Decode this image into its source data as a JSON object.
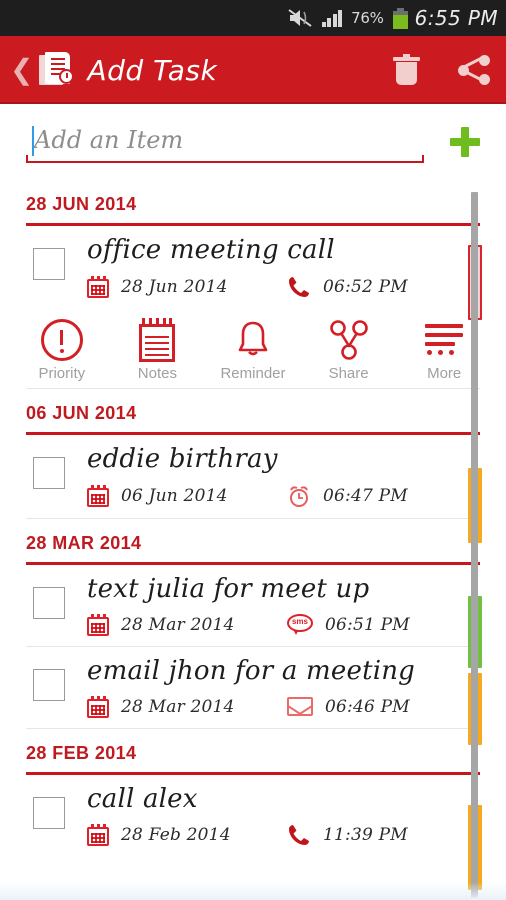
{
  "statusbar": {
    "mute_icon": "mute-vibrate-icon",
    "signal_icon": "signal-bars-icon",
    "battery_percent": "76%",
    "battery_icon": "battery-icon",
    "time": "6:55 PM"
  },
  "appbar": {
    "back_icon": "back-chevron-icon",
    "app_icon": "task-list-clock-icon",
    "title": "Add Task",
    "delete_icon": "trash-icon",
    "share_icon": "share-icon",
    "background_color": "#cc1b20"
  },
  "add_row": {
    "placeholder": "Add an Item",
    "value": "",
    "add_icon": "plus-icon",
    "add_icon_color": "#6dbd1e",
    "underline_color": "#c9161d"
  },
  "action_bar": {
    "items": [
      {
        "label": "Priority",
        "icon": "priority-exclamation-icon"
      },
      {
        "label": "Notes",
        "icon": "notepad-icon"
      },
      {
        "label": "Reminder",
        "icon": "bell-icon"
      },
      {
        "label": "Share",
        "icon": "share-network-icon"
      },
      {
        "label": "More",
        "icon": "more-lines-icon"
      }
    ]
  },
  "groups": [
    {
      "header": "28 JUN 2014",
      "tasks": [
        {
          "title": "office meeting call",
          "date": "28 Jun 2014",
          "time": "06:52 PM",
          "date_icon": "calendar-icon",
          "time_icon": "phone-icon",
          "priority_color": "#d8252c",
          "checked": false,
          "expanded": true
        }
      ]
    },
    {
      "header": "06 JUN 2014",
      "tasks": [
        {
          "title": "eddie birthray",
          "date": "06 Jun 2014",
          "time": "06:47 PM",
          "date_icon": "calendar-icon",
          "time_icon": "alarm-clock-icon",
          "priority_color": "#f4aa1c",
          "checked": false,
          "expanded": false
        }
      ]
    },
    {
      "header": "28 MAR 2014",
      "tasks": [
        {
          "title": "text julia for meet up",
          "date": "28 Mar 2014",
          "time": "06:51 PM",
          "date_icon": "calendar-icon",
          "time_icon": "sms-icon",
          "priority_color": "#72bf44",
          "checked": false,
          "expanded": false
        },
        {
          "title": "email jhon for a meeting",
          "date": "28 Mar 2014",
          "time": "06:46 PM",
          "date_icon": "calendar-icon",
          "time_icon": "mail-icon",
          "priority_color": "#f4aa1c",
          "checked": false,
          "expanded": false
        }
      ]
    },
    {
      "header": "28 FEB 2014",
      "tasks": [
        {
          "title": "call alex",
          "date": "28 Feb 2014",
          "time": "11:39 PM",
          "date_icon": "calendar-icon",
          "time_icon": "phone-icon",
          "priority_color": "#f4aa1c",
          "checked": false,
          "expanded": false
        }
      ]
    }
  ]
}
